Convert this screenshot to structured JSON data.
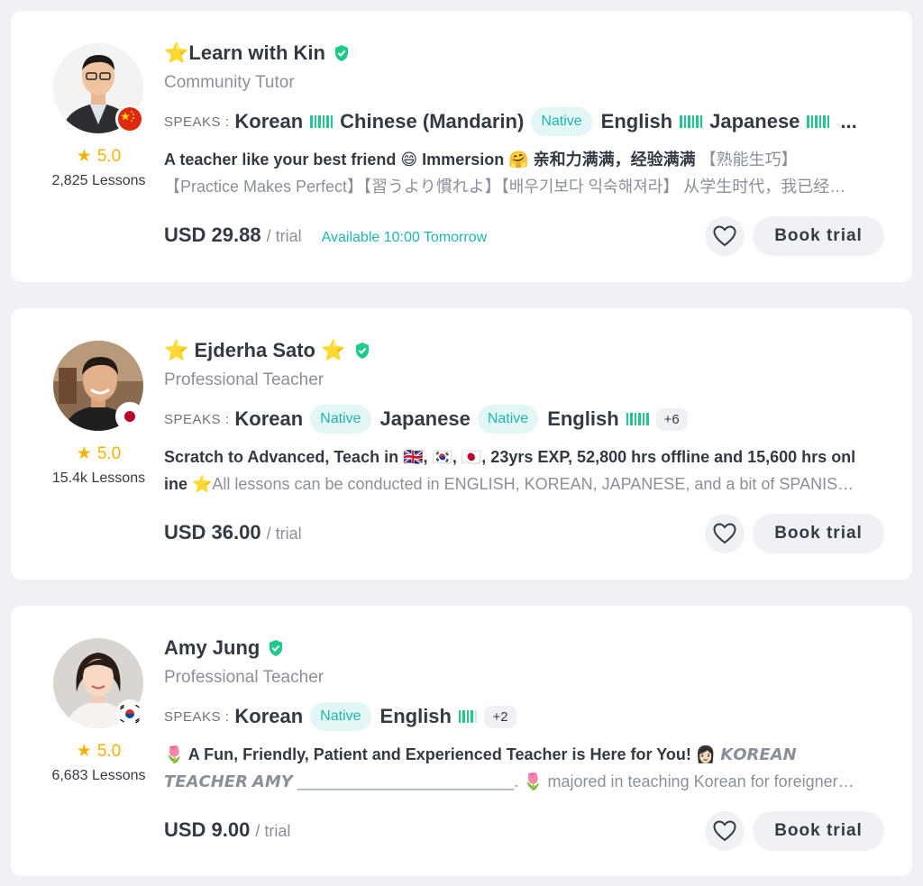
{
  "speaks_label": "SPEAKS :",
  "per_label": "/ trial",
  "book_label": "Book trial",
  "tutors": [
    {
      "name": "⭐Learn with Kin",
      "role": "Community Tutor",
      "rating": "5.0",
      "lessons": "2,825 Lessons",
      "flag": "China",
      "languages": [
        {
          "name": "Korean",
          "level": "bars"
        },
        {
          "name": "Chinese (Mandarin)",
          "level": "Native"
        },
        {
          "name": "English",
          "level": "bars"
        },
        {
          "name": "Japanese",
          "level": "bars"
        }
      ],
      "more": "...",
      "desc_line1": "A teacher like your best friend 😄 Immersion 🤗 亲和力满满，经验满满",
      "desc_line1_gray": " 【熟能生巧】",
      "desc_line2": "【Practice Makes Perfect】【習うより慣れよ】【배우기보다 익숙해져라】 从学生时代，我已经…",
      "price": "USD 29.88",
      "availability": "Available 10:00 Tomorrow"
    },
    {
      "name": "⭐ Ejderha Sato ⭐",
      "role": "Professional Teacher",
      "rating": "5.0",
      "lessons": "15.4k Lessons",
      "flag": "Japan",
      "languages": [
        {
          "name": "Korean",
          "level": "Native"
        },
        {
          "name": "Japanese",
          "level": "Native"
        },
        {
          "name": "English",
          "level": "bars"
        }
      ],
      "more": "+6",
      "desc_line1": "Scratch to Advanced, Teach in 🇬🇧, 🇰🇷, 🇯🇵, 23yrs EXP, 52,800 hrs offline and 15,600 hrs onl",
      "desc_line2_bold": "ine ⭐",
      "desc_line2": "All lessons can be conducted in ENGLISH, KOREAN, JAPANESE, and a bit of SPANIS…",
      "price": "USD 36.00",
      "availability": ""
    },
    {
      "name": "Amy Jung",
      "role": "Professional Teacher",
      "rating": "5.0",
      "lessons": "6,683 Lessons",
      "flag": "South Korea",
      "languages": [
        {
          "name": "Korean",
          "level": "Native"
        },
        {
          "name": "English",
          "level": "bars"
        }
      ],
      "more": "+2",
      "desc_line1": "🌷 A Fun, Friendly, Patient and Experienced Teacher is Here for You! 👩🏻",
      "desc_line1_gray": " 𝙆𝙊𝙍𝙀𝘼𝙉",
      "desc_line2": "𝙏𝙀𝘼𝘾𝙃𝙀𝙍 𝘼𝙈𝙔 ________________________. 🌷 majored in teaching Korean for foreigner…",
      "price": "USD 9.00",
      "availability": ""
    }
  ]
}
